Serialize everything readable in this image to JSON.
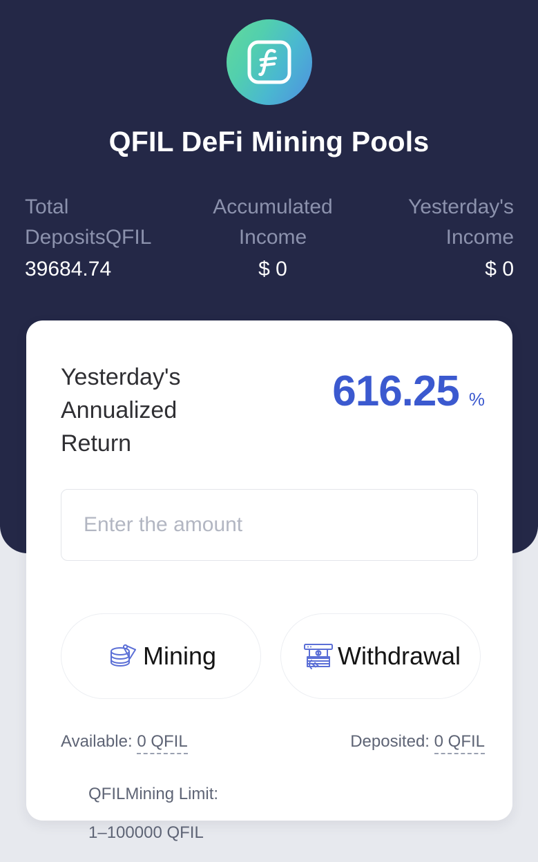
{
  "header": {
    "logo_icon": "filecoin-logo-icon",
    "title": "QFIL DeFi Mining Pools",
    "stats": [
      {
        "label": "Total\nDepositsQFIL",
        "value": "39684.74"
      },
      {
        "label": "Accumulated\nIncome",
        "value": "$ 0"
      },
      {
        "label": "Yesterday's\nIncome",
        "value": "$ 0"
      }
    ]
  },
  "card": {
    "apr": {
      "label": "Yesterday's\nAnnualized\nReturn",
      "value": "616.25",
      "unit": "%",
      "color": "#3b59cf"
    },
    "amount_input": {
      "placeholder": "Enter the amount",
      "value": ""
    },
    "actions": [
      {
        "label": "Mining",
        "icon": "mining-pickaxe-icon"
      },
      {
        "label": "Withdrawal",
        "icon": "atm-cash-icon"
      }
    ],
    "balances": [
      {
        "label": "Available:",
        "value": "0 QFIL"
      },
      {
        "label": "Deposited:",
        "value": "0 QFIL"
      }
    ],
    "limit": {
      "label": "QFILMining Limit:",
      "value": "1–100000 QFIL"
    }
  },
  "theme": {
    "panel_bg": "#242847",
    "page_bg": "#e7e9ee",
    "card_bg": "#ffffff",
    "accent": "#3b59cf",
    "icon_blue": "#5b6fd6",
    "muted_text": "#8c92ad"
  }
}
